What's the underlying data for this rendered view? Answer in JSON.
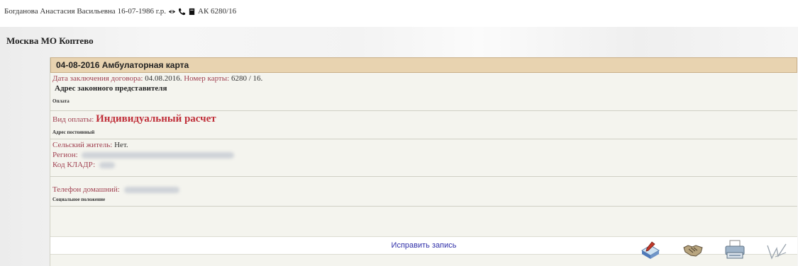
{
  "patient": {
    "name": "Богданова Анастасия Васильевна",
    "birth": "16-07-1986 г.р.",
    "card_code": "АК 6280/16"
  },
  "region": {
    "title": "Москва МО Коптево"
  },
  "card": {
    "header": "04-08-2016 Амбулаторная карта",
    "contract_date_label": "Дата заключения договора:",
    "contract_date_value": "04.08.2016.",
    "card_number_label": "Номер карты:",
    "card_number_value": "6280 / 16.",
    "legal_rep_heading": "Адрес законного представителя",
    "payment_heading": "Оплата",
    "payment_type_label": "Вид оплаты:",
    "payment_type_value": "Индивидуальный расчет",
    "permanent_address_heading": "Адрес постоянный",
    "rural_label": "Сельский житель:",
    "rural_value": "Нет.",
    "region_label": "Регион:",
    "kladr_label": "Код КЛАДР:",
    "home_phone_label": "Телефон домашний:",
    "social_status_heading": "Социальное положение",
    "edit_label": "Исправить запись"
  },
  "icons": {
    "patient_line": [
      "eye-icon",
      "phone-icon",
      "document-icon"
    ],
    "toolbar": [
      "book-pen-icon",
      "handshake-icon",
      "printer-icon",
      "signature-icon"
    ]
  },
  "colors": {
    "header_bg": "#e8d3b0",
    "label": "#a04050",
    "payment_value": "#c0303a",
    "edit_link": "#2e2ea8"
  }
}
